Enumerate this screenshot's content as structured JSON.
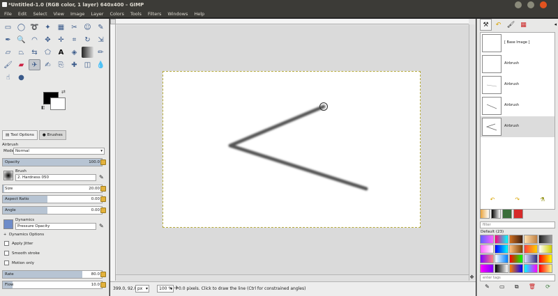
{
  "window": {
    "title": "*Untitled-1.0 (RGB color, 1 layer) 640x400 – GIMP"
  },
  "menu": [
    "File",
    "Edit",
    "Select",
    "View",
    "Image",
    "Layer",
    "Colors",
    "Tools",
    "Filters",
    "Windows",
    "Help"
  ],
  "toolbox": {
    "tool_options_tab": "Tool Options",
    "brushes_tab": "Brushes"
  },
  "tool_options": {
    "tool_name": "Airbrush",
    "mode_label": "Mode:",
    "mode_value": "Normal",
    "opacity_label": "Opacity",
    "opacity_value": "100.0",
    "opacity_fraction": 1.0,
    "brush_label": "Brush",
    "brush_value": "2. Hardness 050",
    "size_label": "Size",
    "size_value": "20.00",
    "aspect_label": "Aspect Ratio",
    "aspect_value": "0.00",
    "angle_label": "Angle",
    "angle_value": "0.00",
    "dynamics_label": "Dynamics",
    "dynamics_value": "Pressure Opacity",
    "dynamics_options": "Dynamics Options",
    "apply_jitter": "Apply Jitter",
    "smooth_stroke": "Smooth stroke",
    "motion_only": "Motion only",
    "rate_label": "Rate",
    "rate_value": "80.0",
    "rate_fraction": 0.8,
    "flow_label": "Flow",
    "flow_value": "10.0",
    "flow_fraction": 0.1
  },
  "statusbar": {
    "coords": "399.0, 92.0",
    "unit": "px",
    "zoom": "100 %",
    "message": "0.0 pixels. Click to draw the line (Ctrl for constrained angles)"
  },
  "undo_history": {
    "items": [
      "[ Base Image ]",
      "Airbrush",
      "Airbrush",
      "Airbrush",
      "Airbrush"
    ],
    "selected_index": 4
  },
  "gradients": {
    "filter_placeholder": "filter",
    "default_label": "Default (23)",
    "tags_placeholder": "enter tags"
  }
}
